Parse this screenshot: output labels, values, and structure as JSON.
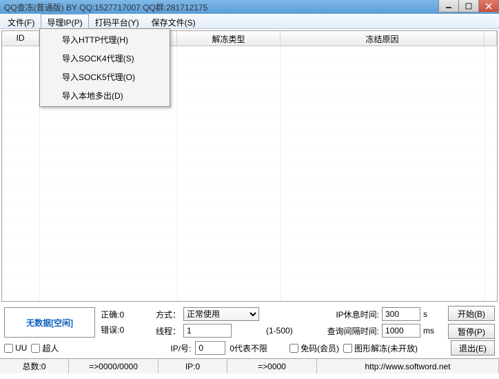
{
  "title": "QQ查冻(普通版) BY QQ:1527717007 QQ群:281712175",
  "menu": {
    "file": "文件(F)",
    "proxy": "导理IP(P)",
    "platform": "打码平台(Y)",
    "save": "保存文件(S)",
    "dropdown": {
      "http": "导入HTTP代理(H)",
      "sock4": "导入SOCK4代理(S)",
      "sock5": "导入SOCK5代理(O)",
      "local": "导入本地多出(D)"
    }
  },
  "grid": {
    "col_id": "ID",
    "col_type": "解冻类型",
    "col_reason": "冻结原因"
  },
  "panel": {
    "nodata": "无数据[空闲]",
    "correct": "正确:0",
    "error": "错误:0"
  },
  "form": {
    "mode_label": "方式：",
    "mode_value": "正常使用",
    "thread_label": "线程：",
    "thread_value": "1",
    "thread_range": "(1-500)",
    "iprest_label": "IP休息时间:",
    "iprest_value": "300",
    "iprest_unit": "s",
    "interval_label": "查询间隔时间:",
    "interval_value": "1000",
    "interval_unit": "ms",
    "ipno_label": "IP/号:",
    "ipno_value": "0",
    "ipno_hint": "0代表不限"
  },
  "checks": {
    "uu": "UU",
    "superman": "超人",
    "freecode": "免码(会员)",
    "graphic": "图形解冻(未开放)"
  },
  "buttons": {
    "start": "开始(B)",
    "pause": "暂停(P)",
    "exit": "退出(E)"
  },
  "status": {
    "total": "总数:0",
    "progress": "=>0000/0000",
    "ip": "IP:0",
    "arrow": "=>0000",
    "url": "http://www.softword.net"
  }
}
